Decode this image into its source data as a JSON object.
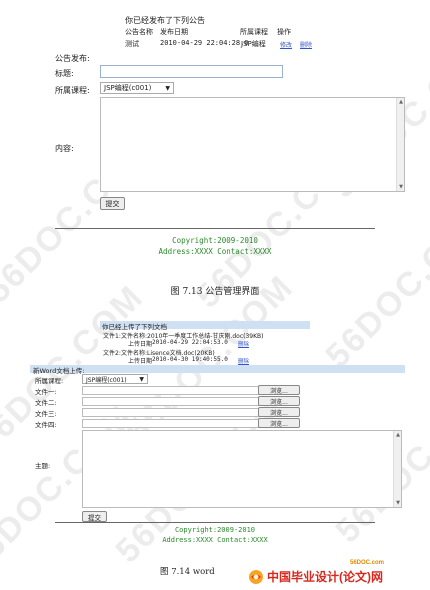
{
  "watermark": "56DOC.COM",
  "fig1": {
    "header": "你已经发布了下列公告",
    "columns": [
      "公告名称",
      "发布日期",
      "所属课程",
      "操作"
    ],
    "row": {
      "name": "测试",
      "date": "2010-04-29 22:04:28.0",
      "course": "JSP编程",
      "action_edit": "修改",
      "action_delete": "删除"
    },
    "labels": {
      "publish": "公告发布:",
      "title": "标题:",
      "course": "所属课程:",
      "content": "内容:"
    },
    "course_select": "JSP编程(c001)",
    "submit": "提交",
    "footer_line1": "Copyright:2009-2010",
    "footer_line2": "Address:XXXX Contact:XXXX",
    "caption": "图 7.13  公告管理界面"
  },
  "fig2": {
    "header": "你已经上传了下列文档",
    "files": [
      {
        "label": "文件1:",
        "name": "文件名称:2010年一季度工作总结-甘庆刚.doc(39KB)",
        "date_label": "上传日期",
        "date": "2010-04-29 22:04:53.0",
        "action": "删除"
      },
      {
        "label": "文件2:",
        "name": "文件名称:Lisence文档.doc(20KB)",
        "date_label": "上传日期",
        "date": "2010-04-30 19:40:55.0",
        "action": "删除"
      }
    ],
    "upload_header": "新Word文档上传:",
    "course_label": "所属课程:",
    "course_select": "JSP编程(c001)",
    "file_labels": [
      "文件一:",
      "文件二:",
      "文件三:",
      "文件四:"
    ],
    "browse": "浏览...",
    "subject_label": "主题:",
    "submit": "提交",
    "footer_line1": "Copyright:2009-2010",
    "footer_line2": "Address:XXXX Contact:XXXX",
    "caption": "图 7.14  word"
  },
  "branding": {
    "site": "56DOC.com",
    "logo_text": "中国毕业设计(论文)网"
  }
}
